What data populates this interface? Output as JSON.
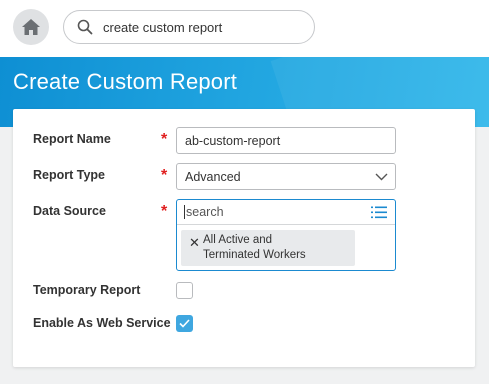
{
  "header": {
    "home_icon": "home-icon",
    "search": {
      "value": "create custom report",
      "icon": "search-icon"
    }
  },
  "page": {
    "title": "Create Custom Report"
  },
  "form": {
    "report_name": {
      "label": "Report Name",
      "value": "ab-custom-report",
      "required": true
    },
    "report_type": {
      "label": "Report Type",
      "value": "Advanced",
      "required": true,
      "icon": "chevron-down-icon"
    },
    "data_source": {
      "label": "Data Source",
      "placeholder": "search",
      "required": true,
      "icon": "list-icon",
      "selected": [
        {
          "line1": "All Active and",
          "line2": "Terminated Workers"
        }
      ]
    },
    "temporary_report": {
      "label": "Temporary Report",
      "checked": false
    },
    "enable_web_service": {
      "label": "Enable As Web Service",
      "checked": true
    }
  },
  "required_marker": "*",
  "colors": {
    "accent": "#1b8ad0",
    "banner": "#21a5e0",
    "required": "#e01f1f",
    "checkbox": "#3fa7e0"
  }
}
